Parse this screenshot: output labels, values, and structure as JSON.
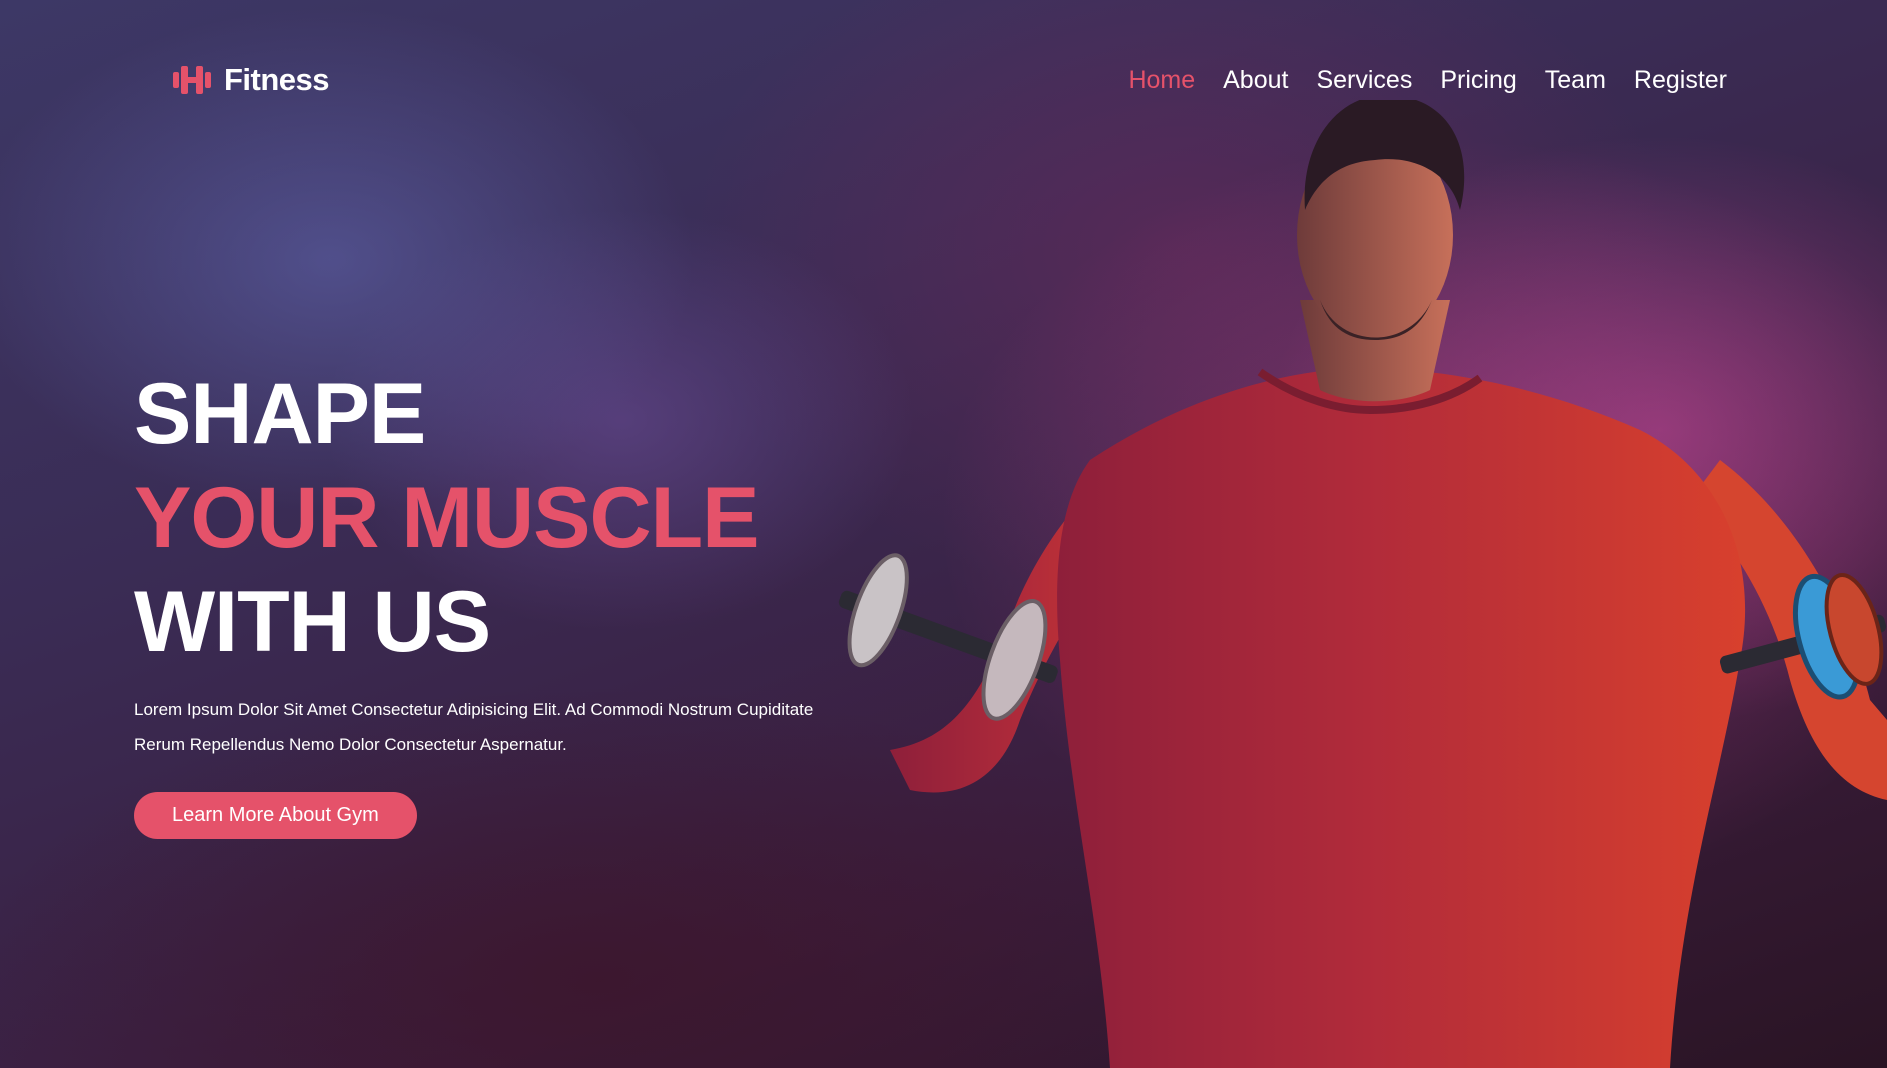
{
  "brand": {
    "icon": "dumbbell-icon",
    "name": "Fitness",
    "accent_color": "#e5526a"
  },
  "nav": {
    "items": [
      {
        "label": "Home",
        "active": true
      },
      {
        "label": "About",
        "active": false
      },
      {
        "label": "Services",
        "active": false
      },
      {
        "label": "Pricing",
        "active": false
      },
      {
        "label": "Team",
        "active": false
      },
      {
        "label": "Register",
        "active": false
      }
    ]
  },
  "hero": {
    "title_line1": "SHAPE",
    "title_line2": "YOUR MUSCLE",
    "title_line3": "WITH US",
    "description": "Lorem Ipsum Dolor Sit Amet Consectetur Adipisicing Elit. Ad Commodi Nostrum Cupiditate Rerum Repellendus Nemo Dolor Consectetur Aspernatur.",
    "cta_label": "Learn More About Gym",
    "image": "man-lifting-dumbbells-photo"
  }
}
